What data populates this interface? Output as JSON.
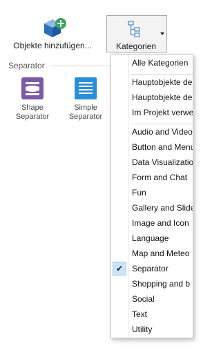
{
  "toolbar": {
    "add_objects_label": "Objekte hinzufügen...",
    "categories_label": "Kategorien"
  },
  "section": {
    "title": "Separator"
  },
  "gallery": {
    "items": [
      {
        "line1": "Shape",
        "line2": "Separator"
      },
      {
        "line1": "Simple",
        "line2": "Separator"
      }
    ]
  },
  "menu": {
    "group1": [
      {
        "label": "Alle Kategorien"
      }
    ],
    "group2": [
      {
        "label": "Hauptobjekte der Anwendung"
      },
      {
        "label": "Hauptobjekte der Seite"
      },
      {
        "label": "Im Projekt verwendet"
      }
    ],
    "group3": [
      {
        "label": "Audio and Video"
      },
      {
        "label": "Button and Menu"
      },
      {
        "label": "Data Visualization"
      },
      {
        "label": "Form and Chat"
      },
      {
        "label": "Fun"
      },
      {
        "label": "Gallery and Slider"
      },
      {
        "label": "Image and Icon"
      },
      {
        "label": "Language"
      },
      {
        "label": "Map and Meteo"
      },
      {
        "label": "Separator",
        "checked": true
      },
      {
        "label": "Shopping and b"
      },
      {
        "label": "Social"
      },
      {
        "label": "Text"
      },
      {
        "label": "Utility"
      }
    ],
    "check_glyph": "✔"
  },
  "colors": {
    "accent_purple": "#7b5aa6",
    "accent_blue": "#2a8fd6",
    "add_green": "#3aa55c",
    "check_highlight": "#cce4f7"
  }
}
